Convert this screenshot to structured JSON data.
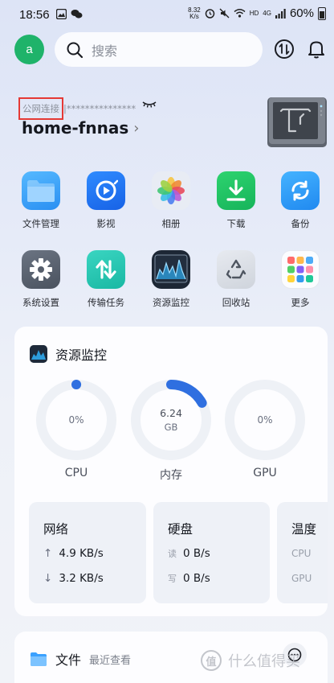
{
  "status_bar": {
    "time": "18:56",
    "net_speed_value": "8.32",
    "net_speed_unit": "K/s",
    "hd_label": "HD",
    "signal_label": "4G",
    "battery": "60%"
  },
  "topbar": {
    "avatar_letter": "a",
    "search_placeholder": "搜索"
  },
  "server": {
    "connection_label": "公网连接",
    "masked_address": "|***************",
    "name": "home-fnnas",
    "chevron": "›"
  },
  "apps": [
    {
      "label": "文件管理"
    },
    {
      "label": "影视"
    },
    {
      "label": "相册"
    },
    {
      "label": "下载"
    },
    {
      "label": "备份"
    },
    {
      "label": "系统设置"
    },
    {
      "label": "传输任务"
    },
    {
      "label": "资源监控"
    },
    {
      "label": "回收站"
    },
    {
      "label": "更多"
    }
  ],
  "resource_monitor": {
    "title": "资源监控",
    "gauges": [
      {
        "name": "CPU",
        "value_text": "0%",
        "fraction": 0.0
      },
      {
        "name": "内存",
        "value_text": "6.24",
        "unit": "GB",
        "fraction": 0.17
      },
      {
        "name": "GPU",
        "value_text": "0%",
        "fraction": 0.0
      }
    ],
    "network": {
      "title": "网络",
      "up_arrow": "↑",
      "upload": "4.9 KB/s",
      "down_arrow": "↓",
      "download": "3.2 KB/s"
    },
    "disk": {
      "title": "硬盘",
      "read_label": "读",
      "read": "0 B/s",
      "write_label": "写",
      "write": "0 B/s"
    },
    "temperature": {
      "title": "温度",
      "cpu_label": "CPU",
      "gpu_label": "GPU"
    }
  },
  "files": {
    "title": "文件",
    "subtitle": "最近查看"
  },
  "watermark": {
    "badge": "值",
    "text": "什么值得买"
  },
  "colors": {
    "accent": "#2f6fe0",
    "avatar_green": "#1fb36a",
    "gauge_track": "#eef1f6",
    "highlight_box": "#e53935"
  }
}
